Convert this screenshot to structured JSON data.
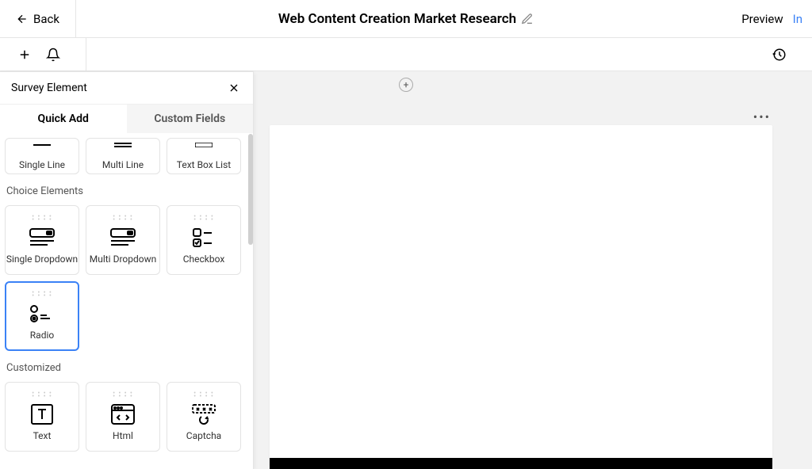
{
  "header": {
    "back": "Back",
    "title": "Web Content Creation Market Research",
    "preview": "Preview",
    "in": "In"
  },
  "panel": {
    "title": "Survey Element",
    "tabs": {
      "quick_add": "Quick Add",
      "custom_fields": "Custom Fields"
    },
    "text_elements": {
      "items": [
        {
          "label": "Single Line"
        },
        {
          "label": "Multi Line"
        },
        {
          "label": "Text Box List"
        }
      ]
    },
    "choice_elements": {
      "heading": "Choice Elements",
      "items": [
        {
          "label": "Single Dropdown"
        },
        {
          "label": "Multi Dropdown"
        },
        {
          "label": "Checkbox"
        },
        {
          "label": "Radio",
          "selected": true
        }
      ]
    },
    "customized": {
      "heading": "Customized",
      "items": [
        {
          "label": "Text"
        },
        {
          "label": "Html"
        },
        {
          "label": "Captcha"
        }
      ]
    }
  }
}
